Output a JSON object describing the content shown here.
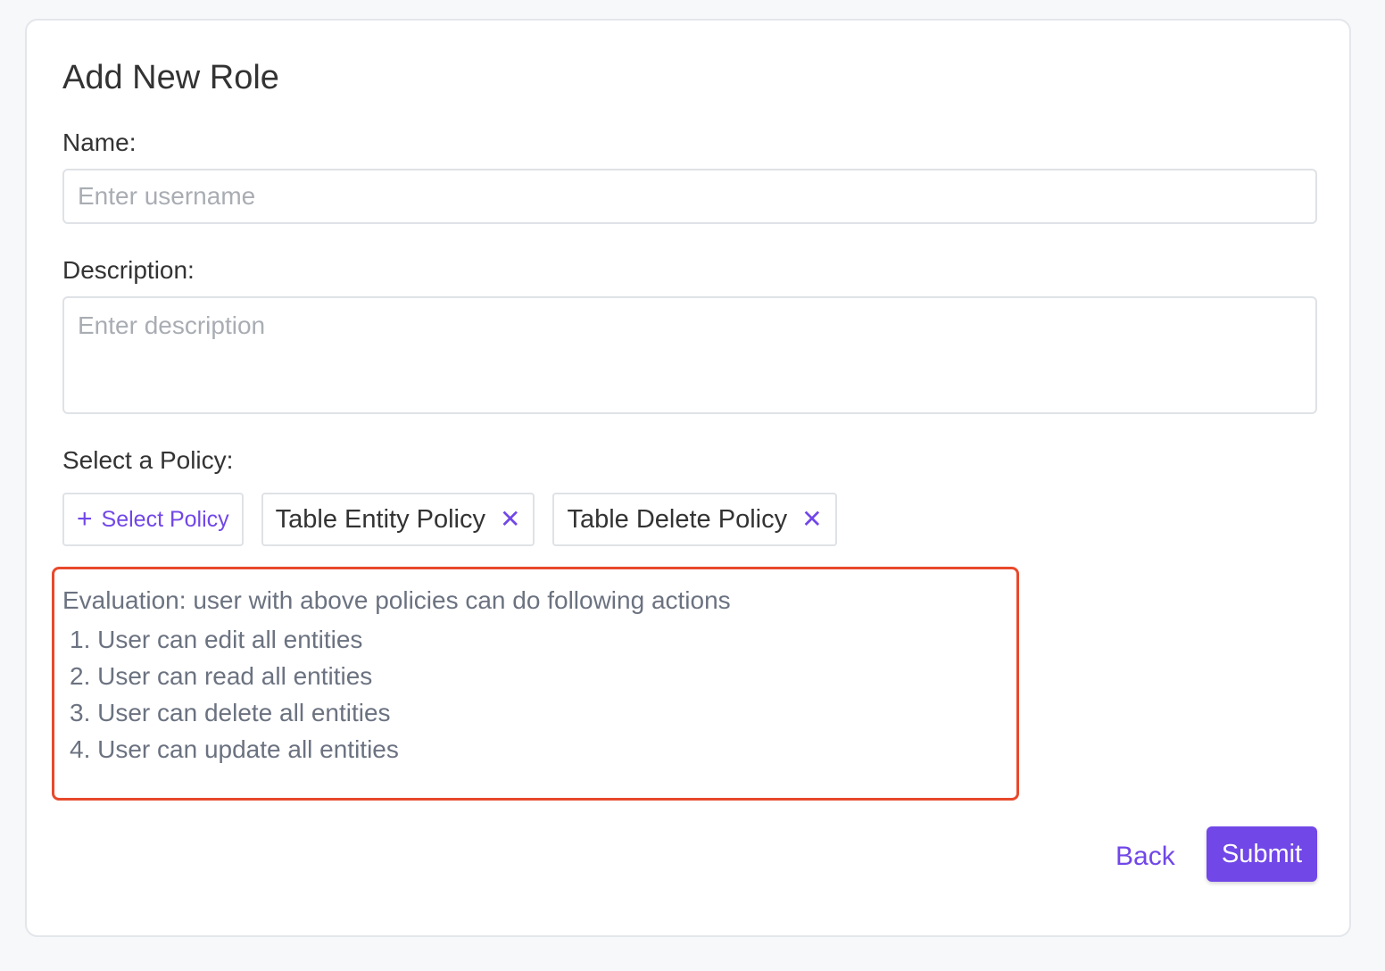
{
  "form": {
    "title": "Add New Role",
    "name_label": "Name:",
    "name_placeholder": "Enter username",
    "name_value": "",
    "description_label": "Description:",
    "description_placeholder": "Enter description",
    "description_value": "",
    "policy_label": "Select a Policy:"
  },
  "policies": {
    "select_label": "Select Policy",
    "select_icon": "plus-icon",
    "selected": [
      {
        "label": "Table Entity Policy",
        "remove_icon": "close-icon"
      },
      {
        "label": "Table Delete Policy",
        "remove_icon": "close-icon"
      }
    ]
  },
  "evaluation": {
    "title": "Evaluation: user with above policies can do following actions",
    "items": [
      "1. User can edit all entities",
      "2. User can read all entities",
      "3. User can delete all entities",
      "4. User can update all entities"
    ]
  },
  "actions": {
    "back_label": "Back",
    "submit_label": "Submit"
  },
  "colors": {
    "accent": "#7147e8",
    "highlight_border": "#e8492c",
    "muted_text": "#6b7280"
  }
}
